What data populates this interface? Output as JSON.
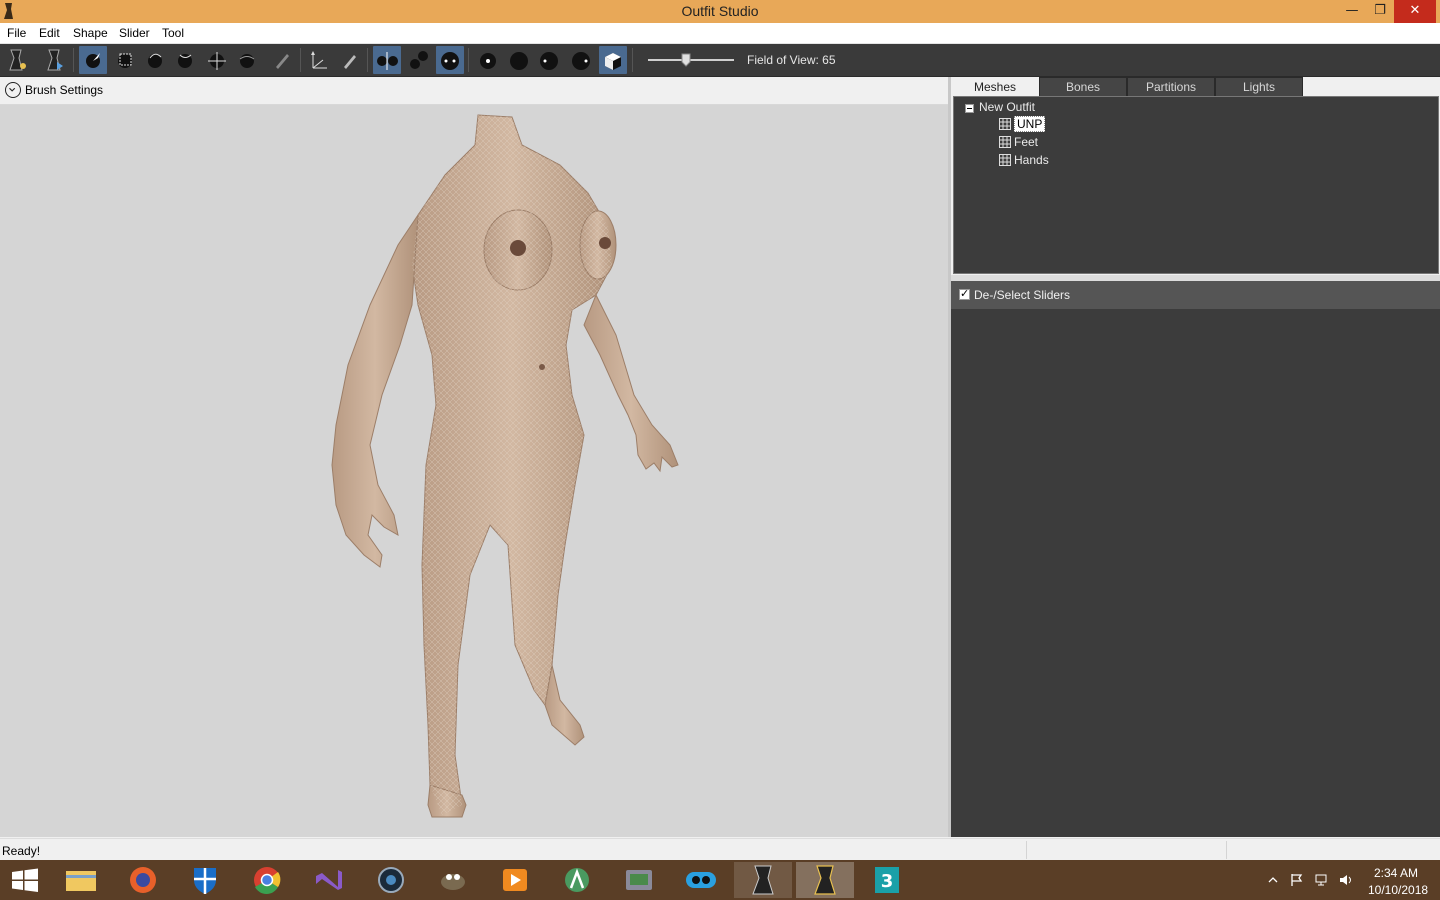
{
  "window": {
    "title": "Outfit Studio"
  },
  "menu": [
    "File",
    "Edit",
    "Shape",
    "Slider",
    "Tool"
  ],
  "toolbar": {
    "field_of_view_label": "Field of View: 65",
    "field_of_view_value": 65
  },
  "brush_settings": {
    "label": "Brush Settings"
  },
  "tabs": [
    "Meshes",
    "Bones",
    "Partitions",
    "Lights"
  ],
  "mesh_tree": {
    "root": "New Outfit",
    "children": [
      "UNP",
      "Feet",
      "Hands"
    ],
    "selected": "UNP"
  },
  "sliders": {
    "label": "De-/Select Sliders",
    "checked": true
  },
  "status": {
    "text": "Ready!"
  },
  "clock": {
    "time": "2:34 AM",
    "date": "10/10/2018"
  },
  "colors": {
    "title_bar": "#e8a858",
    "toolbar": "#3a3a3a",
    "toolbar_active": "#4a6a90",
    "viewport": "#d5d5d5",
    "panel": "#3c3c3c",
    "taskbar": "#5a3e26"
  }
}
